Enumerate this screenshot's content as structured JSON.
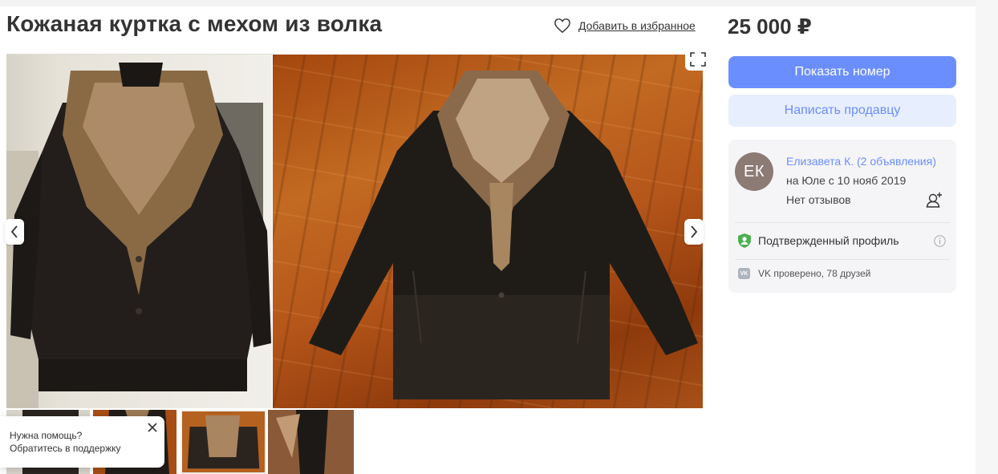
{
  "listing": {
    "title": "Кожаная куртка с мехом из волка",
    "favorite_label": "Добавить в избранное",
    "price": "25 000 ₽"
  },
  "actions": {
    "show_phone": "Показать номер",
    "write_seller": "Написать продавцу"
  },
  "seller": {
    "initials": "ЕК",
    "name": "Елизавета К. (2 объявления)",
    "since": "на Юле с 10 нояб 2019",
    "reviews": "Нет отзывов",
    "verified_label": "Подтвержденный профиль",
    "vk_badge": "VK",
    "vk_text": "VK проверено, 78 друзей"
  },
  "support": {
    "line1": "Нужна помощь?",
    "line2": "Обратитесь в поддержку"
  },
  "colors": {
    "accent": "#6b8eff",
    "accent_light": "#e7eefe",
    "verified_green": "#4caf50",
    "avatar_bg": "#8c7a74"
  },
  "icons": [
    "heart-icon",
    "expand-icon",
    "chevron-left-icon",
    "chevron-right-icon",
    "close-icon",
    "add-user-icon",
    "shield-check-icon",
    "info-icon",
    "vk-icon"
  ]
}
